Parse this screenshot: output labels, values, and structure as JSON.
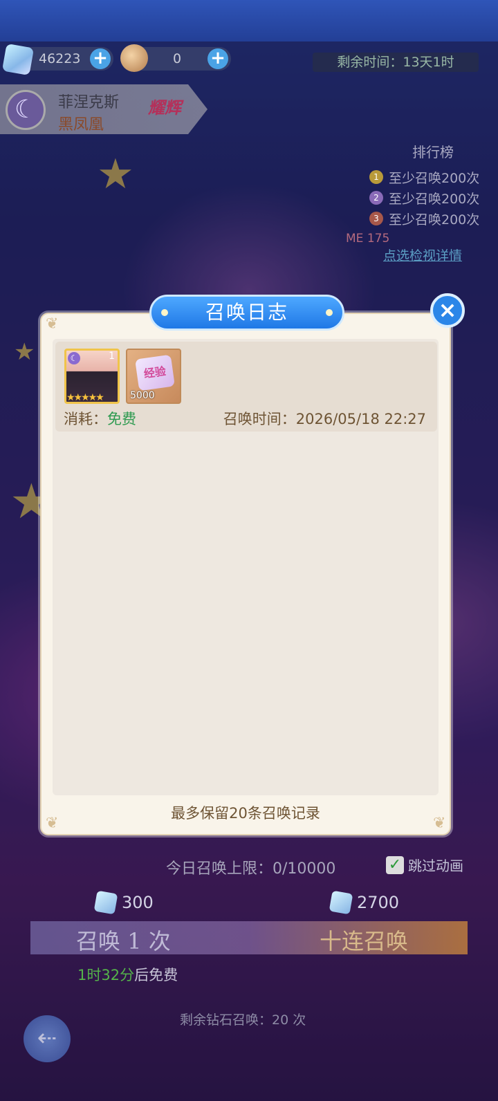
{
  "currency": {
    "gems": "46223",
    "tickets": "0",
    "plus": "+"
  },
  "event_timer": "剩余时间：13天1时",
  "hero": {
    "name": "菲涅克斯",
    "subtitle": "黑凤凰",
    "badge": "耀辉"
  },
  "ranking": {
    "title": "排行榜",
    "rows": [
      "至少召唤200次",
      "至少召唤200次",
      "至少召唤200次"
    ],
    "me": "ME 175",
    "link": "点选检视详情"
  },
  "modal": {
    "title": "召唤日志",
    "close": "×",
    "record": {
      "char_level": "1",
      "char_stars": "★★★★★",
      "item_label": "经验",
      "item_qty": "5000",
      "cost_label": "消耗：",
      "cost_value": "免费",
      "time_label": "召唤时间：",
      "time_value": "2026/05/18 22:27"
    },
    "footnote": "最多保留20条召唤记录"
  },
  "summon": {
    "daily_limit_label": "今日召唤上限：",
    "daily_limit_value": "0/10000",
    "skip_animation": "跳过动画",
    "single_cost": "300",
    "ten_cost": "2700",
    "single_label": "召唤 1 次",
    "ten_label": "十连召唤",
    "free_timer": "1时32分",
    "free_suffix": "后免费",
    "remaining_label": "剩余钻石召唤：",
    "remaining_value": "20 次"
  },
  "colors": {
    "accent_blue": "#2b86e8",
    "free_green": "#2e9a50",
    "text_brown": "#6e5434"
  }
}
